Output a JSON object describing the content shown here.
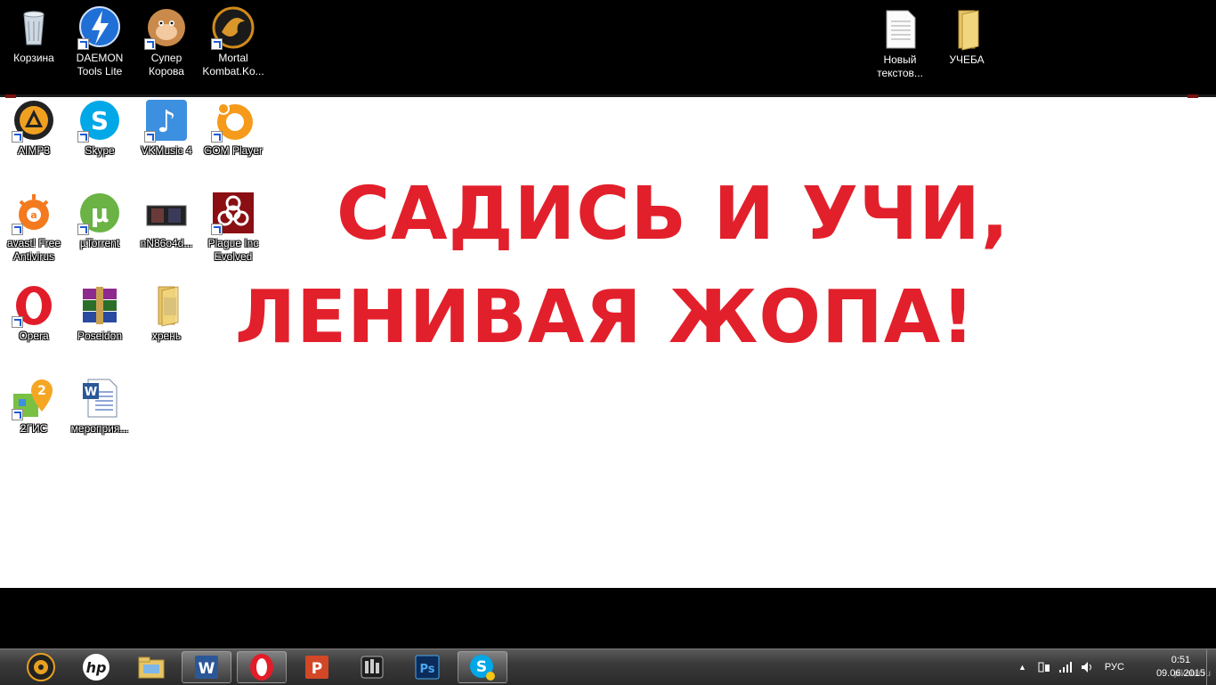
{
  "slogan": {
    "line1": "САДИСЬ И УЧИ,",
    "line2": "ЛЕНИВАЯ ЖОПА!",
    "color": "#e2202b"
  },
  "top_icons": [
    {
      "label": "Корзина",
      "icon": "recycle-bin-icon"
    },
    {
      "label": "DAEMON\nTools Lite",
      "icon": "daemon-tools-icon"
    },
    {
      "label": "Супер\nКорова",
      "icon": "super-cow-icon"
    },
    {
      "label": "Mortal\nKombat.Ko...",
      "icon": "mortal-kombat-icon"
    },
    {
      "label": "Новый\nтекстов...",
      "icon": "text-document-icon"
    },
    {
      "label": "УЧЕБА",
      "icon": "folder-icon"
    }
  ],
  "desktop_icons": [
    {
      "label": "AIMP3",
      "icon": "aimp-icon"
    },
    {
      "label": "Skype",
      "icon": "skype-icon"
    },
    {
      "label": "VKMusic 4",
      "icon": "vkmusic-icon"
    },
    {
      "label": "GOM Player",
      "icon": "gom-player-icon"
    },
    {
      "label": "avast! Free\nAntivirus",
      "icon": "avast-icon"
    },
    {
      "label": "µTorrent",
      "icon": "utorrent-icon"
    },
    {
      "label": "nN86o4d...",
      "icon": "image-file-icon"
    },
    {
      "label": "Plague Inc\nEvolved",
      "icon": "plague-inc-icon"
    },
    {
      "label": "Opera",
      "icon": "opera-icon"
    },
    {
      "label": "Poseidon",
      "icon": "winrar-icon"
    },
    {
      "label": "хрень",
      "icon": "folder-icon"
    },
    {
      "label": "2ГИС",
      "icon": "2gis-icon"
    },
    {
      "label": "мероприя...",
      "icon": "word-document-icon"
    }
  ],
  "taskbar": {
    "apps": [
      {
        "name": "aimp",
        "icon": "aimp-taskbar-icon"
      },
      {
        "name": "hp",
        "icon": "hp-icon",
        "text": "hp"
      },
      {
        "name": "explorer",
        "icon": "explorer-folder-icon"
      },
      {
        "name": "word",
        "icon": "word-icon",
        "text": "W"
      },
      {
        "name": "opera",
        "icon": "opera-icon"
      },
      {
        "name": "powerpoint",
        "icon": "powerpoint-icon",
        "text": "P"
      },
      {
        "name": "media",
        "icon": "media-app-icon"
      },
      {
        "name": "photoshop",
        "icon": "photoshop-icon",
        "text": "Ps"
      },
      {
        "name": "skype",
        "icon": "skype-icon",
        "text": "S"
      }
    ],
    "language": "РУС",
    "time": "0:51",
    "date": "09.06.2015",
    "watermark": "pikabu.ru"
  }
}
